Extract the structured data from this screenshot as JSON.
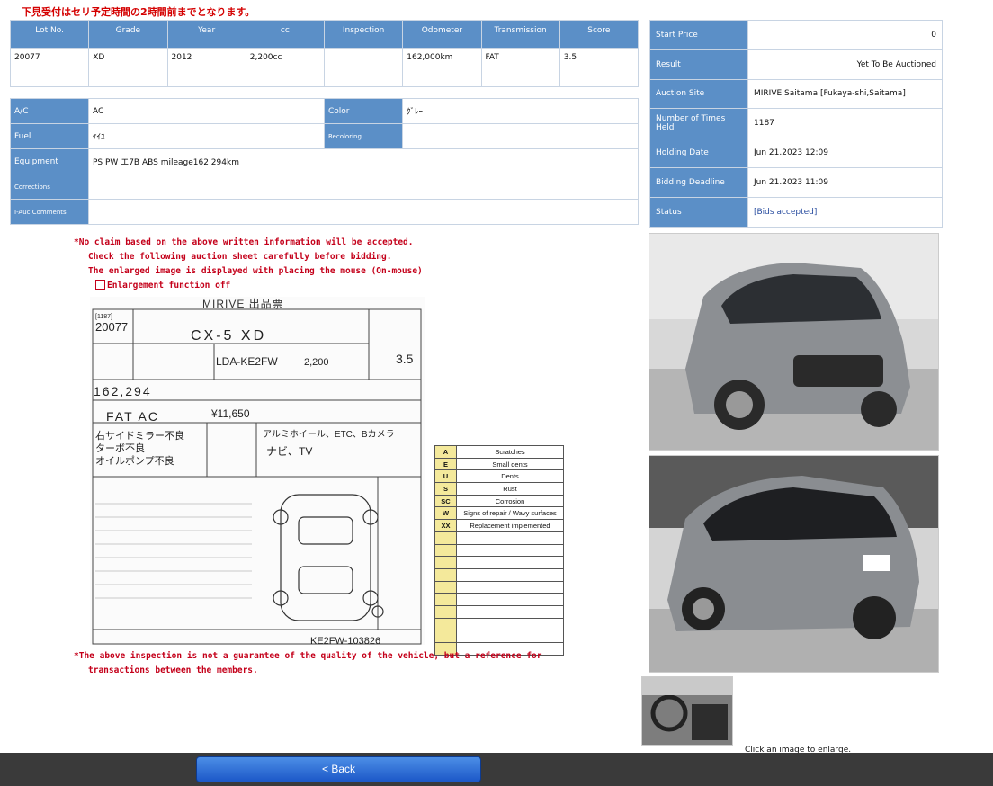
{
  "top_note": "下見受付はセリ予定時間の2時間前までとなります。",
  "spec": {
    "headers": [
      "Lot No.",
      "Grade",
      "Year",
      "cc",
      "Inspection",
      "Odometer",
      "Transmission",
      "Score"
    ],
    "values": [
      "20077",
      "XD",
      "2012",
      "2,200cc",
      "",
      "162,000km",
      "FAT",
      "3.5"
    ]
  },
  "details": {
    "ac_label": "A/C",
    "ac_value": "AC",
    "color_label": "Color",
    "color_value": "ｸﾞﾚｰ",
    "fuel_label": "Fuel",
    "fuel_value": "ｹｲﾕ",
    "recoloring_label": "Recoloring",
    "recoloring_value": "",
    "equipment_label": "Equipment",
    "equipment_value": "PS PW エ7B ABS mileage162,294km",
    "corrections_label": "Corrections",
    "corrections_value": "",
    "comments_label": "I-Auc Comments",
    "comments_value": ""
  },
  "info": {
    "start_price_label": "Start Price",
    "start_price": "0",
    "result_label": "Result",
    "result": "Yet To Be Auctioned",
    "site_label": "Auction Site",
    "site": "MIRIVE Saitama [Fukaya-shi,Saitama]",
    "times_label": "Number of Times Held",
    "times": "1187",
    "holding_label": "Holding Date",
    "holding": "Jun 21.2023 12:09",
    "deadline_label": "Bidding Deadline",
    "deadline": "Jun 21.2023 11:09",
    "status_label": "Status",
    "status": "[Bids accepted]"
  },
  "notes": {
    "line1": "*No claim based on the above written information will be accepted.",
    "line2": "Check the following auction sheet carefully before bidding.",
    "line3": "The enlarged image is displayed with placing the mouse (On-mouse)",
    "enlarge": "Enlargement function off"
  },
  "sheet": {
    "brand": "MIRIVE 出品票",
    "session": "[1187]",
    "lot": "20077",
    "model": "CX-5 XD",
    "chassis": "LDA-KE2FW",
    "cc": "2,200",
    "score": "3.5",
    "mileage": "162,294",
    "trans": "FAT AC",
    "price": "¥11,650",
    "remarks1": "右サイドミラー不良",
    "remarks2": "ターボ不良",
    "remarks3": "オイルポンプ不良",
    "points": "アルミホイール、ETC、Bカメラ",
    "points2": "ナビ、TV",
    "serial": "KE2FW-103826"
  },
  "legend": [
    {
      "k": "A",
      "v": "Scratches"
    },
    {
      "k": "E",
      "v": "Small dents"
    },
    {
      "k": "U",
      "v": "Dents"
    },
    {
      "k": "S",
      "v": "Rust"
    },
    {
      "k": "SC",
      "v": "Corrosion"
    },
    {
      "k": "W",
      "v": "Signs of repair / Wavy surfaces"
    },
    {
      "k": "XX",
      "v": "Replacement implemented"
    }
  ],
  "bottom_note": {
    "line1": "*The above inspection is not a guarantee of the quality of the vehicle, but a reference for",
    "line2": "transactions between the members."
  },
  "photo_note": "Click an image to enlarge.",
  "back_label": "< Back"
}
